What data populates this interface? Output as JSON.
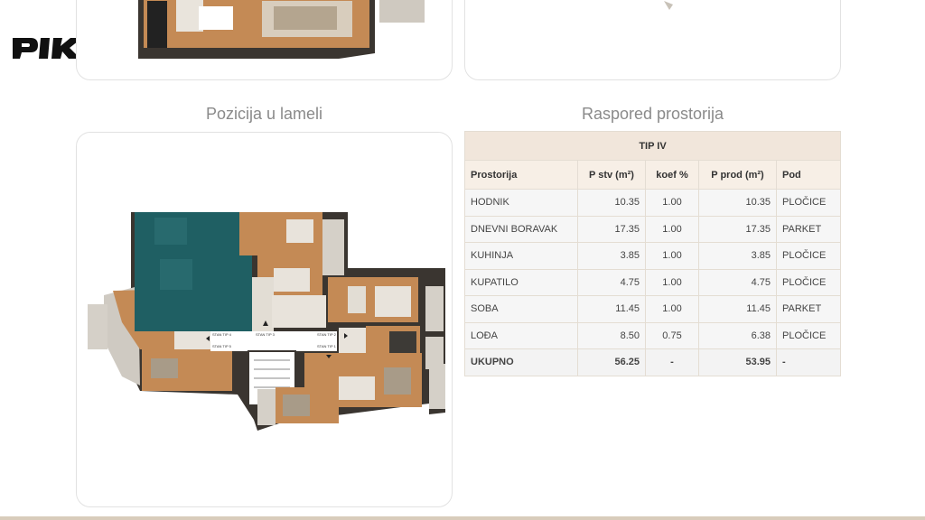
{
  "brand": {
    "logo_text": "PIK"
  },
  "sections": {
    "position_title": "Pozicija u lameli",
    "rooms_title": "Raspored prostorija"
  },
  "plan_labels": {
    "stan4": "STAN TIP 4",
    "stan3": "STAN TIP 3",
    "stan2": "STAN TIP 2",
    "stan5": "STAN TIP 5",
    "stan1": "STAN TIP 1"
  },
  "table": {
    "type_label": "TIP IV",
    "headers": [
      "Prostorija",
      "P stv (m²)",
      "koef %",
      "P prod (m²)",
      "Pod"
    ],
    "rows": [
      [
        "HODNIK",
        "10.35",
        "1.00",
        "10.35",
        "PLOČICE"
      ],
      [
        "DNEVNI BORAVAK",
        "17.35",
        "1.00",
        "17.35",
        "PARKET"
      ],
      [
        "KUHINJA",
        "3.85",
        "1.00",
        "3.85",
        "PLOČICE"
      ],
      [
        "KUPATILO",
        "4.75",
        "1.00",
        "4.75",
        "PLOČICE"
      ],
      [
        "SOBA",
        "11.45",
        "1.00",
        "11.45",
        "PARKET"
      ],
      [
        "LOĐA",
        "8.50",
        "0.75",
        "6.38",
        "PLOČICE"
      ]
    ],
    "total": [
      "UKUPNO",
      "56.25",
      "-",
      "53.95",
      "-"
    ]
  },
  "colors": {
    "highlight": "#1f5f63",
    "floor_wood": "#c48a55",
    "wall": "#3a3530",
    "table_header": "#f1e6db"
  }
}
